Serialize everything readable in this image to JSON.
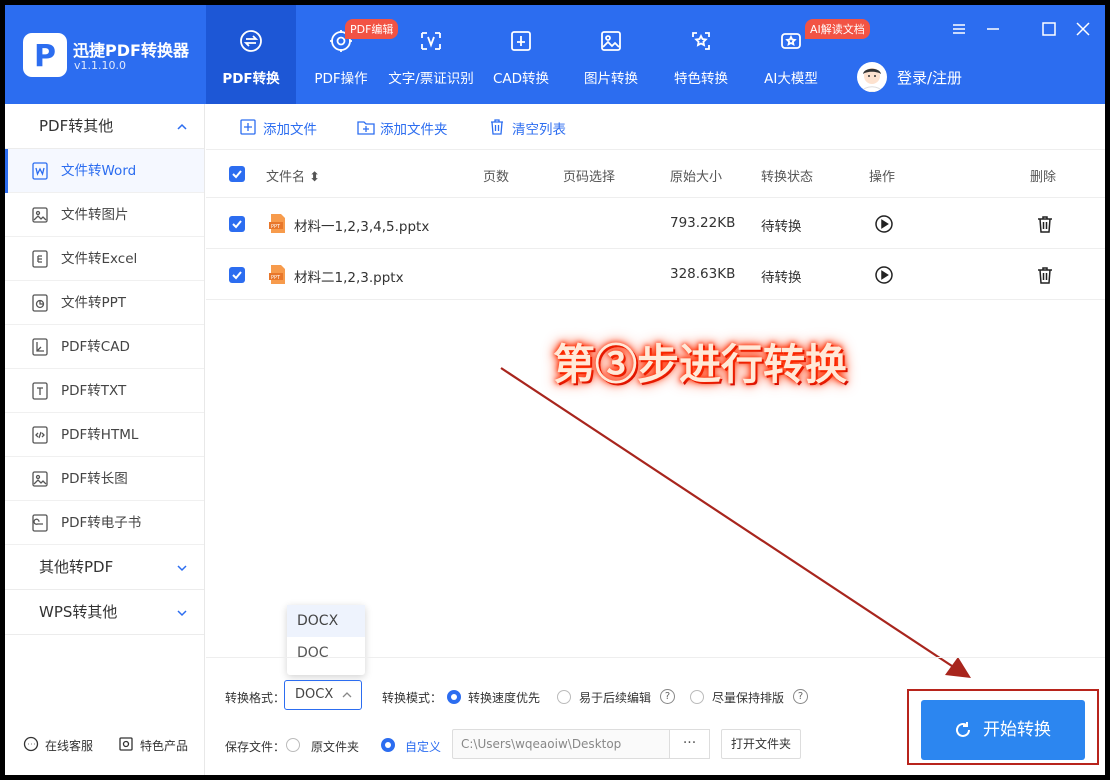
{
  "app": {
    "name": "迅捷PDF转换器",
    "version": "v1.1.10.0",
    "logo_letter": "P"
  },
  "nav": [
    {
      "label": "PDF转换",
      "icon": "convert-icon",
      "active": true
    },
    {
      "label": "PDF操作",
      "icon": "gear-icon",
      "badge": "PDF编辑"
    },
    {
      "label": "文字/票证识别",
      "icon": "scan-text-icon"
    },
    {
      "label": "CAD转换",
      "icon": "cad-icon"
    },
    {
      "label": "图片转换",
      "icon": "image-icon"
    },
    {
      "label": "特色转换",
      "icon": "star-icon"
    },
    {
      "label": "AI大模型",
      "icon": "ai-icon",
      "badge": "AI解读文档"
    }
  ],
  "user": {
    "login_label": "登录/注册"
  },
  "sidebar": {
    "group_pdf": "PDF转其他",
    "items": [
      "文件转Word",
      "文件转图片",
      "文件转Excel",
      "文件转PPT",
      "PDF转CAD",
      "PDF转TXT",
      "PDF转HTML",
      "PDF转长图",
      "PDF转电子书"
    ],
    "group_other": "其他转PDF",
    "group_wps": "WPS转其他",
    "footer": {
      "service": "在线客服",
      "products": "特色产品"
    }
  },
  "toolbar": {
    "add_file": "添加文件",
    "add_folder": "添加文件夹",
    "clear_list": "清空列表"
  },
  "table": {
    "headers": {
      "name": "文件名 ⬍",
      "pages": "页数",
      "page_select": "页码选择",
      "size": "原始大小",
      "status": "转换状态",
      "action": "操作",
      "delete": "删除"
    },
    "rows": [
      {
        "name": "材料一1,2,3,4,5.pptx",
        "size": "793.22KB",
        "status": "待转换"
      },
      {
        "name": "材料二1,2,3.pptx",
        "size": "328.63KB",
        "status": "待转换"
      }
    ]
  },
  "annotation": {
    "text": "第③步进行转换"
  },
  "format": {
    "label": "转换格式：",
    "selected": "DOCX",
    "options": [
      "DOCX",
      "DOC"
    ]
  },
  "mode": {
    "label": "转换模式：",
    "opt1": "转换速度优先",
    "opt2": "易于后续编辑",
    "opt3": "尽量保持排版"
  },
  "save": {
    "label": "保存文件：",
    "opt_original": "原文件夹",
    "opt_custom": "自定义",
    "path": "C:\\Users\\wqeaoiw\\Desktop",
    "browse": "···",
    "open_folder": "打开文件夹"
  },
  "start_button": "开始转换",
  "colors": {
    "brand": "#2c6df0",
    "badge": "#f25344",
    "annotation": "#ff2a00",
    "highlight": "#b8241c"
  }
}
